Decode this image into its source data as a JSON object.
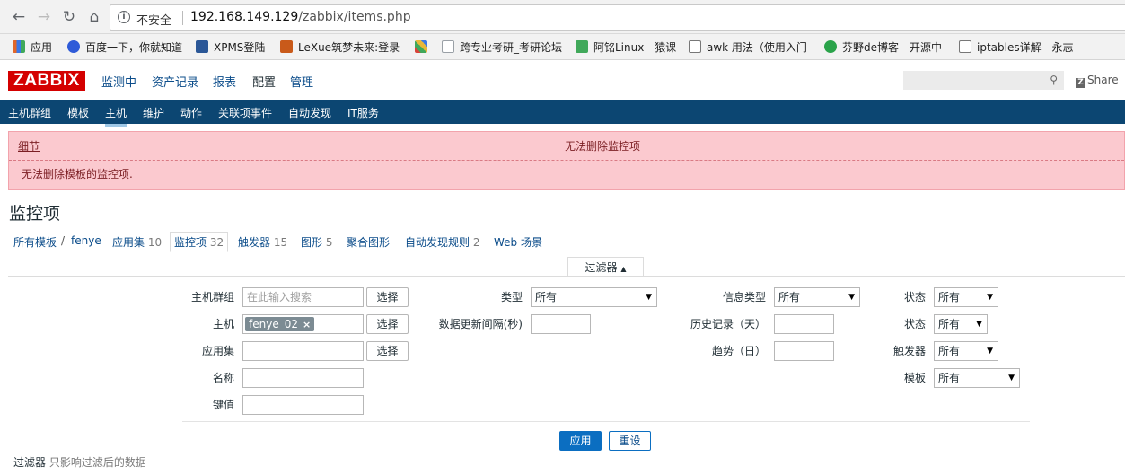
{
  "browser": {
    "insecure_label": "不安全",
    "url_host": "192.168.149.129",
    "url_path": "/zabbix/items.php"
  },
  "bookmarks": [
    {
      "label": "应用",
      "color": "#e2672a"
    },
    {
      "label": "百度一下，你就知道",
      "color": "#2f5bd8"
    },
    {
      "label": "XPMS登陆",
      "color": "#2b5797"
    },
    {
      "label": "LeXue筑梦未来:登录",
      "color": "#c95a1a"
    },
    {
      "label": "",
      "color": "#d8433a"
    },
    {
      "label": "跨专业考研_考研论坛",
      "color": "#9aa0a6"
    },
    {
      "label": "阿铭Linux - 猿课",
      "color": "#40a85a"
    },
    {
      "label": "awk 用法（使用入门",
      "color": "#777777"
    },
    {
      "label": "芬野de博客 - 开源中",
      "color": "#2aa34a"
    },
    {
      "label": "iptables详解 - 永志",
      "color": "#777777"
    }
  ],
  "zabbix": {
    "logo": "ZABBIX",
    "top_nav": [
      "监测中",
      "资产记录",
      "报表",
      "配置",
      "管理"
    ],
    "top_nav_selected": "配置",
    "share": "Share",
    "sub_nav": [
      "主机群组",
      "模板",
      "主机",
      "维护",
      "动作",
      "关联项事件",
      "自动发现",
      "IT服务"
    ],
    "sub_nav_selected": "主机"
  },
  "error": {
    "details_label": "细节",
    "title": "无法删除监控项",
    "message": "无法删除模板的监控项."
  },
  "page": {
    "title": "监控项",
    "breadcrumbs": {
      "all_templates": "所有模板",
      "host": "fenye",
      "applications": "应用集",
      "applications_count": "10",
      "items": "监控项",
      "items_count": "32",
      "triggers": "触发器",
      "triggers_count": "15",
      "graphs": "图形",
      "graphs_count": "5",
      "screens": "聚合图形",
      "discovery": "自动发现规则",
      "discovery_count": "2",
      "web": "Web 场景"
    }
  },
  "filter": {
    "tab_label": "过滤器",
    "host_group_label": "主机群组",
    "host_group_placeholder": "在此输入搜索",
    "host_label": "主机",
    "host_tag": "fenye_02",
    "application_label": "应用集",
    "name_label": "名称",
    "key_label": "键值",
    "select_button": "选择",
    "type_label": "类型",
    "type_value": "所有",
    "update_interval_label": "数据更新间隔(秒)",
    "info_type_label": "信息类型",
    "info_type_value": "所有",
    "history_label": "历史记录（天）",
    "trends_label": "趋势（日）",
    "status_label": "状态",
    "status_value": "所有",
    "state_label": "状态",
    "state_value": "所有",
    "triggers_label": "触发器",
    "triggers_value": "所有",
    "template_label": "模板",
    "template_value": "所有",
    "apply_button": "应用",
    "reset_button": "重设",
    "note_label": "过滤器",
    "note_text": "只影响过滤后的数据"
  }
}
